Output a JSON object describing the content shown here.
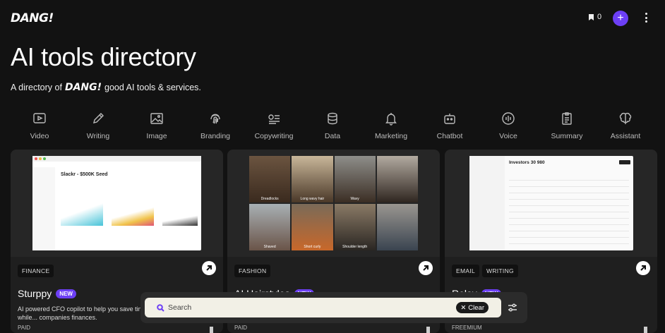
{
  "header": {
    "logo": "DANG!",
    "bookmark_count": "0",
    "add_symbol": "+"
  },
  "hero": {
    "title": "AI tools directory",
    "sub_pre": "A directory of",
    "sub_logo": "DANG!",
    "sub_post": "good AI tools & services."
  },
  "categories": [
    {
      "label": "Video",
      "icon": "video-icon"
    },
    {
      "label": "Writing",
      "icon": "pencil-icon"
    },
    {
      "label": "Image",
      "icon": "image-icon"
    },
    {
      "label": "Branding",
      "icon": "fingerprint-icon"
    },
    {
      "label": "Copywriting",
      "icon": "copywriting-icon"
    },
    {
      "label": "Data",
      "icon": "database-icon"
    },
    {
      "label": "Marketing",
      "icon": "bell-icon"
    },
    {
      "label": "Chatbot",
      "icon": "robot-icon"
    },
    {
      "label": "Voice",
      "icon": "voice-icon"
    },
    {
      "label": "Summary",
      "icon": "clipboard-icon"
    },
    {
      "label": "Assistant",
      "icon": "brain-icon"
    }
  ],
  "cards": [
    {
      "tags": [
        "FINANCE"
      ],
      "title": "Sturppy",
      "badge": "NEW",
      "desc": "AI powered CFO copilot to help you save time while... companies finances.",
      "price": "PAID",
      "thumb_title": "Slackr - $500K Seed"
    },
    {
      "tags": [
        "FASHION"
      ],
      "title": "AI Hairstyles",
      "badge": "NEW",
      "desc": "",
      "price": "PAID",
      "thumb_labels": [
        "Dreadlocks",
        "Long wavy hair",
        "Wavy",
        "",
        "Shaved",
        "Short curly",
        "Shoulder length",
        ""
      ]
    },
    {
      "tags": [
        "EMAIL",
        "WRITING"
      ],
      "title": "Relay",
      "badge": "NEW",
      "desc": "...and management tool.",
      "price": "FREEMIUM",
      "thumb_title": "Investors 30 980"
    }
  ],
  "search": {
    "placeholder": "Search",
    "clear_label": "Clear"
  },
  "colors": {
    "accent": "#6c3ff5",
    "bg": "#121212",
    "card": "#1f1f1f"
  }
}
